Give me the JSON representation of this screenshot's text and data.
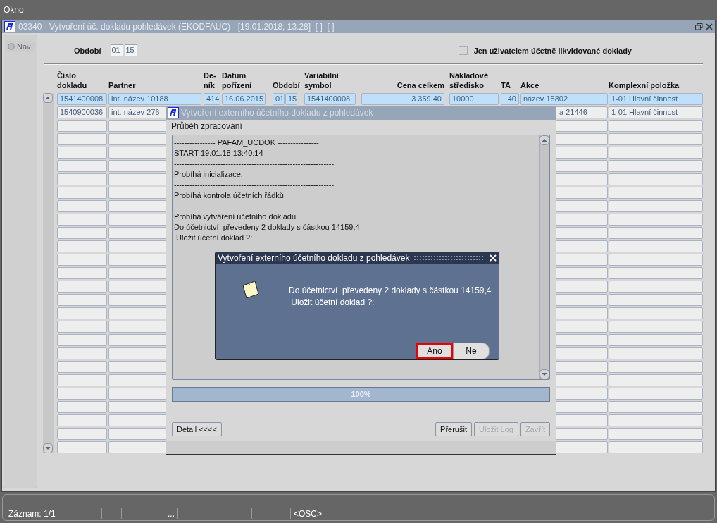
{
  "menu": [
    {
      "label": "Okno"
    }
  ],
  "window": {
    "title": "03340 - Vytvoření úč. dokladu pohledávek (EKODFAUC) - [19.01.2018; 13:28]  [ ]  [ ]",
    "nav": {
      "label": "Nav"
    }
  },
  "filter": {
    "period_label": "Období",
    "period": [
      "01",
      "15"
    ],
    "checkbox": {
      "label": "Jen uživatelem účetně likvidované doklady",
      "checked": false
    }
  },
  "table": {
    "columns": [
      {
        "label": "Číslo\ndokladu"
      },
      {
        "label": "Partner"
      },
      {
        "label": "De-\nník"
      },
      {
        "label": "Datum\npořízení"
      },
      {
        "label": "Období"
      },
      {
        "label": "Variabilní\nsymbol"
      },
      {
        "label": "Cena celkem"
      },
      {
        "label": "Nákladové\nstředisko"
      },
      {
        "label": "TA"
      },
      {
        "label": "Akce"
      },
      {
        "label": "Komplexní položka"
      }
    ],
    "rows": [
      {
        "selected": true,
        "cells": {
          "cislo": "1541400008",
          "partner": "int. název 10188",
          "denik": "414",
          "datum": "16.06.2015",
          "obdobi_1": "01",
          "obdobi_2": "15",
          "vs": "1541400008",
          "cena": "3 359.40",
          "stredisko": "10000",
          "ta": "40",
          "akce": "název 15802",
          "komplex": "1-01 Hlavní činnost"
        }
      },
      {
        "selected": false,
        "cells": {
          "cislo": "1540900036",
          "partner": "int. název 276",
          "akce": "a 21446",
          "komplex": "1-01 Hlavní činnost"
        }
      }
    ]
  },
  "progress_dialog": {
    "title": "Vytvoření externího účetního dokladu z pohledávek",
    "section_label": "Průběh zpracování",
    "log": [
      "---------------- PAFAM_UCDOK ----------------",
      "START 19.01.18 13:40:14",
      "--------------------------------------------------------------",
      "Probíhá inicializace.",
      "--------------------------------------------------------------",
      "Probíhá kontrola účetních řádků.",
      "--------------------------------------------------------------",
      "Probíhá vytváření účetního dokladu.",
      "Do účetnictví  převedeny 2 doklady s částkou 14159,4",
      " Uložit účetní doklad ?:"
    ],
    "progress": {
      "level": 1,
      "label": "100%"
    },
    "detail_button": {
      "label": "Detail <<<<"
    },
    "buttons": [
      {
        "label": "Přerušit",
        "disabled": false
      },
      {
        "label": "Uložit Log",
        "disabled": true
      },
      {
        "label": "Zavřít",
        "disabled": true
      }
    ]
  },
  "message_dialog": {
    "title": "Vytvoření externího účetního dokladu z pohledávek",
    "message": "Do účetnictví  převedeny 2 doklady s částkou 14159,4\n Uložit účetní doklad ?:",
    "buttons": [
      {
        "label": "Ano",
        "focused": true
      },
      {
        "label": "Ne",
        "focused": false
      }
    ]
  },
  "status_bar": {
    "record": "Záznam: 1/1",
    "ellipsis": "...",
    "mode": "<OSC>"
  }
}
